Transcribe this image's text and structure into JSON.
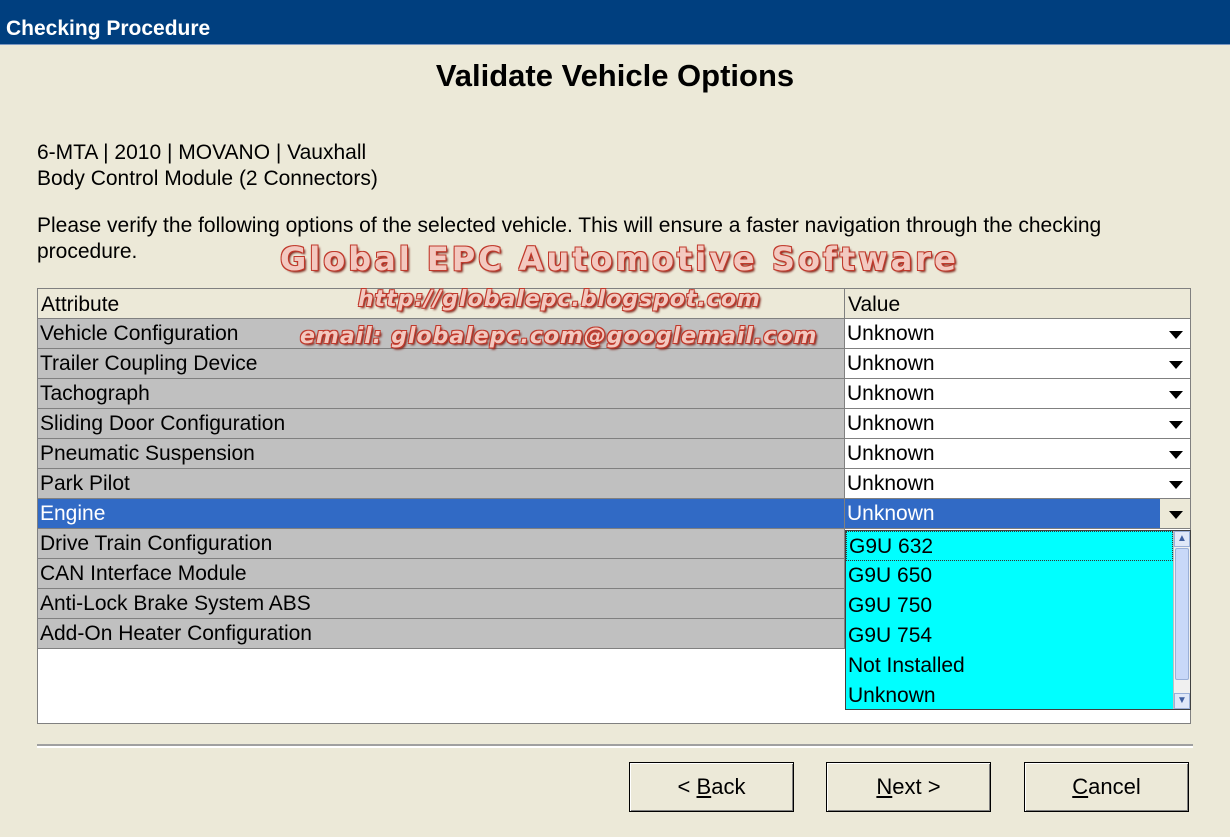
{
  "window": {
    "title": "Checking Procedure"
  },
  "heading": "Validate Vehicle Options",
  "vehicle": {
    "line1": "6-MTA | 2010 | MOVANO | Vauxhall",
    "line2": "Body Control Module (2 Connectors)"
  },
  "instructions": "Please verify the following options of the selected vehicle. This will ensure a faster navigation through the checking procedure.",
  "watermark": {
    "title": "Global EPC Automotive Software",
    "url": "http://globalepc.blogspot.com",
    "email": "email: globalepc.com@googlemail.com"
  },
  "table": {
    "headers": {
      "attribute": "Attribute",
      "value": "Value"
    },
    "rows": [
      {
        "attribute": "Vehicle Configuration",
        "value": "Unknown"
      },
      {
        "attribute": "Trailer Coupling Device",
        "value": "Unknown"
      },
      {
        "attribute": "Tachograph",
        "value": "Unknown"
      },
      {
        "attribute": "Sliding Door Configuration",
        "value": "Unknown"
      },
      {
        "attribute": "Pneumatic Suspension",
        "value": "Unknown"
      },
      {
        "attribute": "Park Pilot",
        "value": "Unknown"
      },
      {
        "attribute": "Engine",
        "value": "Unknown"
      },
      {
        "attribute": "Drive Train Configuration",
        "value": ""
      },
      {
        "attribute": "CAN Interface Module",
        "value": ""
      },
      {
        "attribute": "Anti-Lock Brake System ABS",
        "value": ""
      },
      {
        "attribute": "Add-On Heater Configuration",
        "value": ""
      }
    ],
    "selected_row": "Engine"
  },
  "dropdown": {
    "options": [
      "G9U 632",
      "G9U 650",
      "G9U 750",
      "G9U 754",
      "Not Installed",
      "Unknown"
    ]
  },
  "buttons": {
    "back": {
      "prefix": "< ",
      "key": "B",
      "rest": "ack"
    },
    "next": {
      "key": "N",
      "rest": "ext >"
    },
    "cancel": {
      "key": "C",
      "rest": "ancel"
    }
  },
  "colors": {
    "titlebar": "#003f7f",
    "selection": "#316ac5",
    "dropdown_bg": "#00ffff",
    "attr_cell": "#c0c0c0"
  }
}
